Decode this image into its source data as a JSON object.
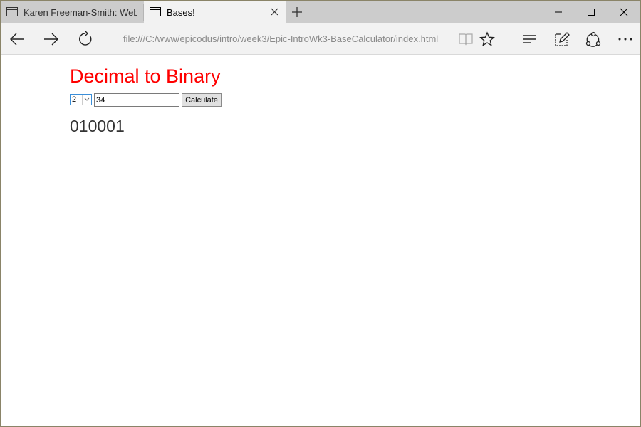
{
  "tabs": [
    {
      "title": "Karen Freeman-Smith: Web",
      "active": false
    },
    {
      "title": "Bases!",
      "active": true
    }
  ],
  "icons": {
    "tab": "page-icon",
    "close": "close-icon",
    "new_tab": "plus-icon",
    "minimize": "minimize-icon",
    "maximize": "maximize-icon",
    "window_close": "window-close-icon",
    "back": "back-arrow-icon",
    "forward": "forward-arrow-icon",
    "refresh": "refresh-icon",
    "reading_view": "book-icon",
    "favorite": "star-icon",
    "hub": "hub-icon",
    "note": "pen-note-icon",
    "share": "share-icon",
    "more": "more-icon"
  },
  "address": {
    "url": "file:///C:/www/epicodus/intro/week3/Epic-IntroWk3-BaseCalculator/index.html"
  },
  "page": {
    "title": "Decimal to Binary",
    "base_value": "2",
    "number_value": "34",
    "calculate_label": "Calculate",
    "result": "010001"
  },
  "colors": {
    "title": "#ff0000",
    "tabbar": "#cccccc",
    "active_tab": "#f2f2f2"
  }
}
